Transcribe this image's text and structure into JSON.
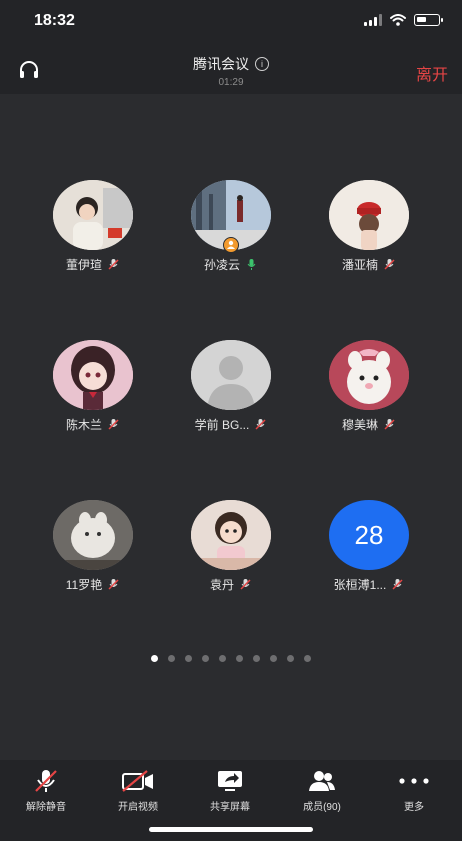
{
  "status_bar": {
    "time": "18:32",
    "battery_level": 0.45
  },
  "header": {
    "title": "腾讯会议",
    "timer": "01:29",
    "leave_label": "离开"
  },
  "participants": [
    {
      "name": "董伊瑄",
      "mic": "muted",
      "avatar": "photo-girl"
    },
    {
      "name": "孙凌云",
      "mic": "on",
      "avatar": "photo-outdoor",
      "host": true
    },
    {
      "name": "潘亚楠",
      "mic": "muted",
      "avatar": "photo-red-hat"
    },
    {
      "name": "陈木兰",
      "mic": "muted",
      "avatar": "anime-girl"
    },
    {
      "name": "学前 BG...",
      "mic": "muted",
      "avatar": "default-silhouette"
    },
    {
      "name": "穆美琳",
      "mic": "muted",
      "avatar": "plush-toy"
    },
    {
      "name": "11罗艳",
      "mic": "muted",
      "avatar": "photo-cat"
    },
    {
      "name": "袁丹",
      "mic": "muted",
      "avatar": "photo-child"
    },
    {
      "name": "张桓溥1...",
      "mic": "muted",
      "avatar": "number",
      "number": "28"
    }
  ],
  "pagination": {
    "total": 10,
    "current": 1
  },
  "toolbar": {
    "unmute_label": "解除静音",
    "video_label": "开启视频",
    "share_label": "共享屏幕",
    "members_label": "成员(90)",
    "more_label": "更多"
  },
  "colors": {
    "accent_blue": "#1e6ef2",
    "leave_red": "#e54545",
    "mic_green": "#3cc46d",
    "host_orange": "#f29a2e"
  }
}
